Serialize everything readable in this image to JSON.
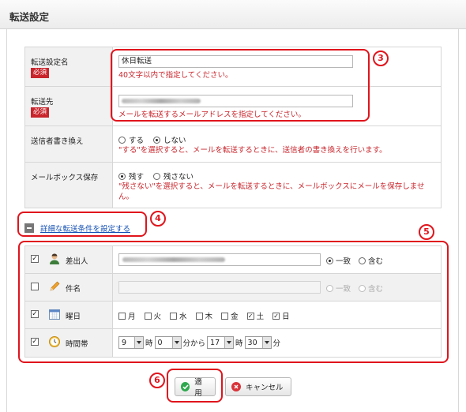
{
  "title": "転送設定",
  "form": {
    "name_label": "転送設定名",
    "name_required": "必須",
    "name_value": "休日転送",
    "name_hint": "40文字以内で指定してください。",
    "dest_label": "転送先",
    "dest_required": "必須",
    "dest_hint": "メールを転送するメールアドレスを指定してください。",
    "rewrite_label": "送信者書き換え",
    "rewrite_option_yes": "する",
    "rewrite_option_no": "しない",
    "rewrite_selected": "しない",
    "rewrite_hint": "\"する\"を選択すると、メールを転送するときに、送信者の書き換えを行います。",
    "mailbox_label": "メールボックス保存",
    "mailbox_option_keep": "残す",
    "mailbox_option_discard": "残さない",
    "mailbox_selected": "残す",
    "mailbox_hint_line1": "\"残さない\"を選択すると、メールを転送するときに、メールボックスにメールを保存しませ",
    "mailbox_hint_line2": "ん。"
  },
  "detail": {
    "link_label": "詳細な転送条件を設定する"
  },
  "conditions": {
    "sender_label": "差出人",
    "sender_checked": true,
    "subject_label": "件名",
    "subject_checked": false,
    "match_exact": "一致",
    "match_contains": "含む",
    "weekday_label": "曜日",
    "weekday_checked": true,
    "days": [
      "月",
      "火",
      "水",
      "木",
      "金",
      "土",
      "日"
    ],
    "days_checked": [
      false,
      false,
      false,
      false,
      false,
      true,
      true
    ],
    "time_label": "時間帯",
    "time_checked": true,
    "start_hour": "9",
    "start_minute": "0",
    "end_hour": "17",
    "end_minute": "30",
    "unit_hour": "時",
    "unit_minute_from": "分から",
    "unit_minute": "分"
  },
  "buttons": {
    "apply": "適用",
    "cancel": "キャンセル"
  },
  "annotations": [
    "3",
    "4",
    "5",
    "6"
  ],
  "colors": {
    "annotation": "#e0141c",
    "hint_text": "#c8252c",
    "link": "#1450b4",
    "apply_icon": "#2fa84f",
    "cancel_icon": "#d8343a"
  }
}
